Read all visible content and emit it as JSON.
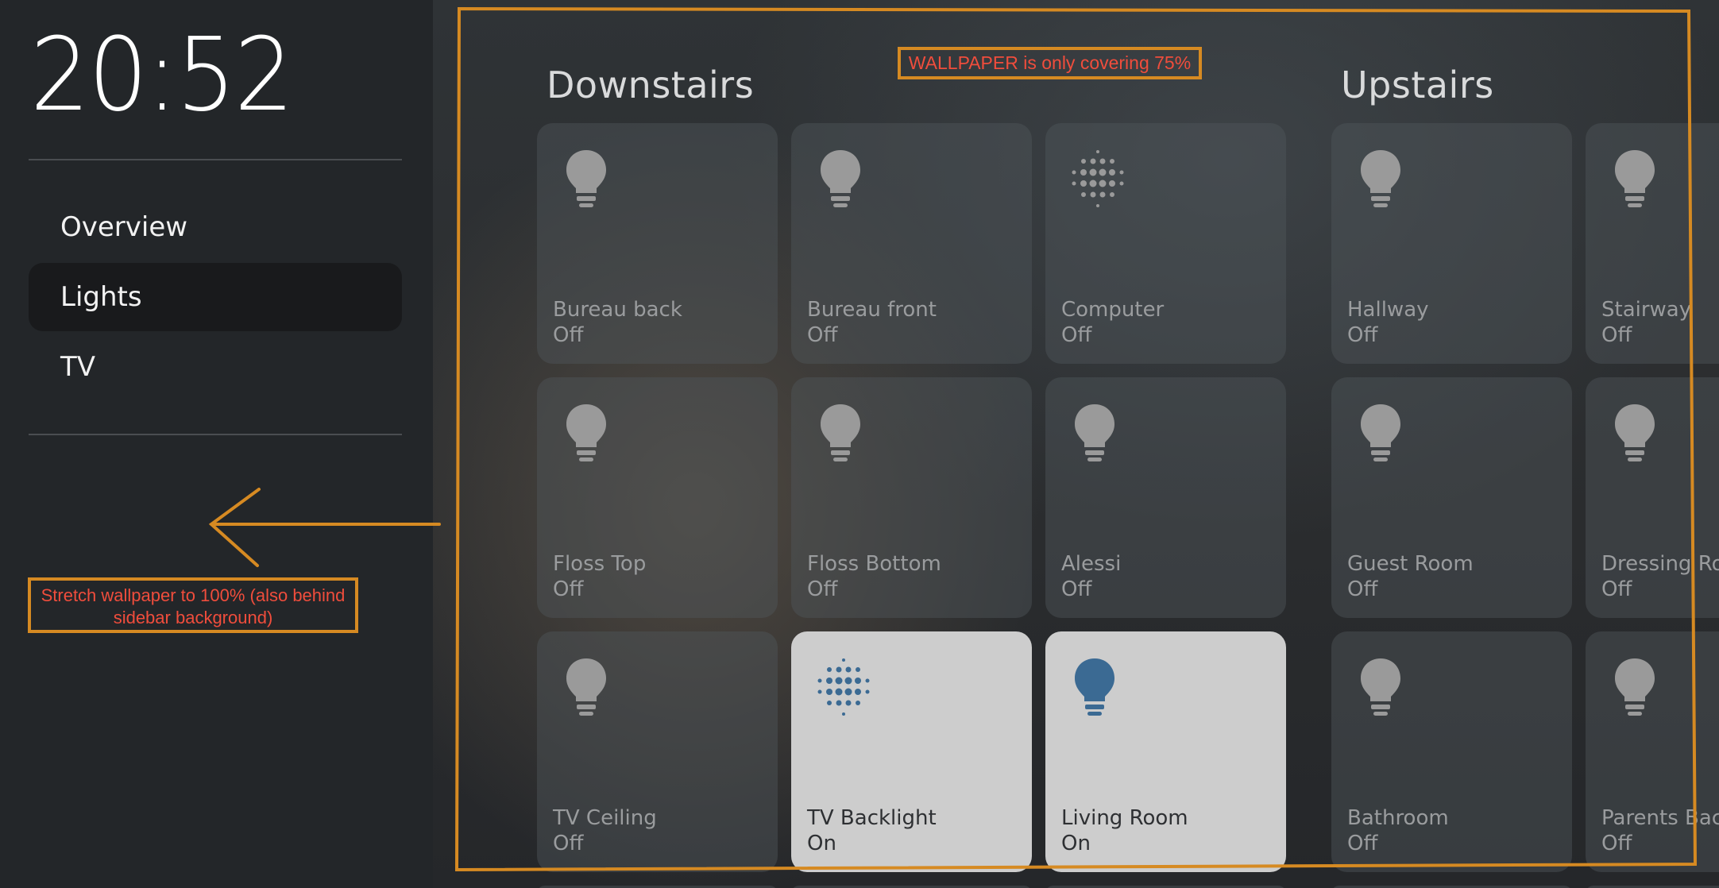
{
  "sidebar": {
    "clock": "20:52",
    "nav": [
      {
        "label": "Overview",
        "active": false
      },
      {
        "label": "Lights",
        "active": true
      },
      {
        "label": "TV",
        "active": false
      }
    ]
  },
  "sections": [
    {
      "title": "Downstairs"
    },
    {
      "title": "Upstairs"
    }
  ],
  "tiles": {
    "bureau_back": {
      "name": "Bureau back",
      "state": "Off",
      "icon": "lightbulb-icon"
    },
    "bureau_front": {
      "name": "Bureau front",
      "state": "Off",
      "icon": "lightbulb-icon"
    },
    "computer": {
      "name": "Computer",
      "state": "Off",
      "icon": "led-strip-icon"
    },
    "floss_top": {
      "name": "Floss Top",
      "state": "Off",
      "icon": "lightbulb-icon"
    },
    "floss_bottom": {
      "name": "Floss Bottom",
      "state": "Off",
      "icon": "lightbulb-icon"
    },
    "alessi": {
      "name": "Alessi",
      "state": "Off",
      "icon": "lightbulb-icon"
    },
    "tv_ceiling": {
      "name": "TV Ceiling",
      "state": "Off",
      "icon": "lightbulb-icon"
    },
    "tv_backlight": {
      "name": "TV Backlight",
      "state": "On",
      "icon": "led-strip-icon"
    },
    "living_room": {
      "name": "Living Room",
      "state": "On",
      "icon": "lightbulb-icon"
    },
    "hallway": {
      "name": "Hallway",
      "state": "Off",
      "icon": "lightbulb-icon"
    },
    "stairway": {
      "name": "Stairway",
      "state": "Off",
      "icon": "lightbulb-icon"
    },
    "guest_room": {
      "name": "Guest Room",
      "state": "Off",
      "icon": "lightbulb-icon"
    },
    "dressing_room": {
      "name": "Dressing Ro",
      "state": "Off",
      "icon": "lightbulb-icon"
    },
    "bathroom": {
      "name": "Bathroom",
      "state": "Off",
      "icon": "lightbulb-icon"
    },
    "parents": {
      "name": "Parents Bac",
      "state": "Off",
      "icon": "lightbulb-icon"
    }
  },
  "annotations": {
    "top_note": "WALLPAPER is only covering 75%",
    "left_note": "Stretch wallpaper to 100% (also behind sidebar background)"
  },
  "colors": {
    "icon_off": "#9a9a9a",
    "icon_on": "#3b6a93",
    "annotation_outline": "#d68a22",
    "annotation_text": "#f04d3c"
  }
}
